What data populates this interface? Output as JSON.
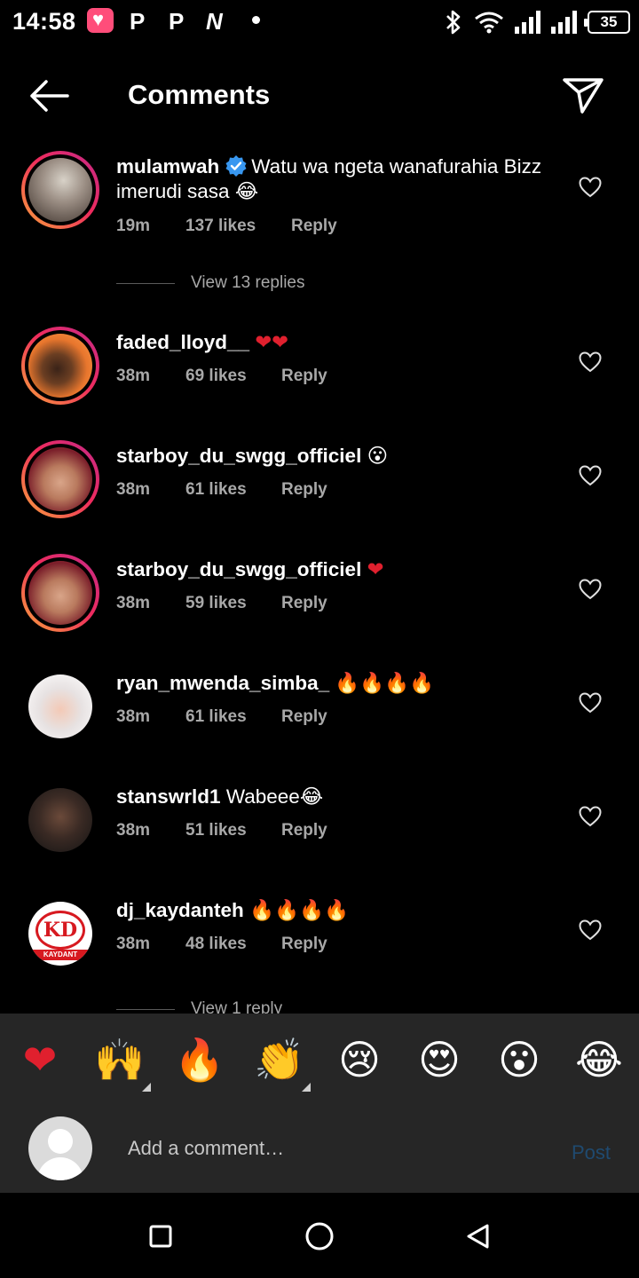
{
  "status_bar": {
    "time": "14:58",
    "notification_letters": [
      "P",
      "P",
      "N"
    ],
    "battery": "35"
  },
  "header": {
    "title": "Comments"
  },
  "comments": [
    {
      "username": "mulamwah",
      "verified": true,
      "text": "Watu wa ngeta wanafurahia Bizz imerudi sasa 😂",
      "time": "19m",
      "likes": "137 likes",
      "reply": "Reply",
      "view_replies": "View 13 replies"
    },
    {
      "username": "faded_lloyd__",
      "text": "❤❤",
      "time": "38m",
      "likes": "69 likes",
      "reply": "Reply"
    },
    {
      "username": "starboy_du_swgg_officiel",
      "text": "😮",
      "time": "38m",
      "likes": "61 likes",
      "reply": "Reply"
    },
    {
      "username": "starboy_du_swgg_officiel",
      "text": "❤",
      "time": "38m",
      "likes": "59 likes",
      "reply": "Reply"
    },
    {
      "username": "ryan_mwenda_simba_",
      "text": "🔥🔥🔥🔥",
      "time": "38m",
      "likes": "61 likes",
      "reply": "Reply"
    },
    {
      "username": "stanswrld1",
      "text": "Wabeee😂",
      "time": "38m",
      "likes": "51 likes",
      "reply": "Reply"
    },
    {
      "username": "dj_kaydanteh",
      "text": "🔥🔥🔥🔥",
      "time": "38m",
      "likes": "48 likes",
      "reply": "Reply",
      "view_replies": "View 1 reply",
      "avatar_logo": "KD",
      "avatar_band": "KAYDANT"
    }
  ],
  "reactions": [
    "❤",
    "🙌",
    "🔥",
    "👏",
    "😢",
    "😍",
    "😮",
    "😂"
  ],
  "composer": {
    "placeholder": "Add a comment…",
    "post_label": "Post"
  },
  "colors": {
    "background": "#000000",
    "panel": "#262626",
    "muted_text": "#a8a8a8",
    "post_disabled": "#1f4a70",
    "story_ring_start": "#f9a33b",
    "story_ring_end": "#c32a8a",
    "verified_blue": "#3897f0"
  }
}
